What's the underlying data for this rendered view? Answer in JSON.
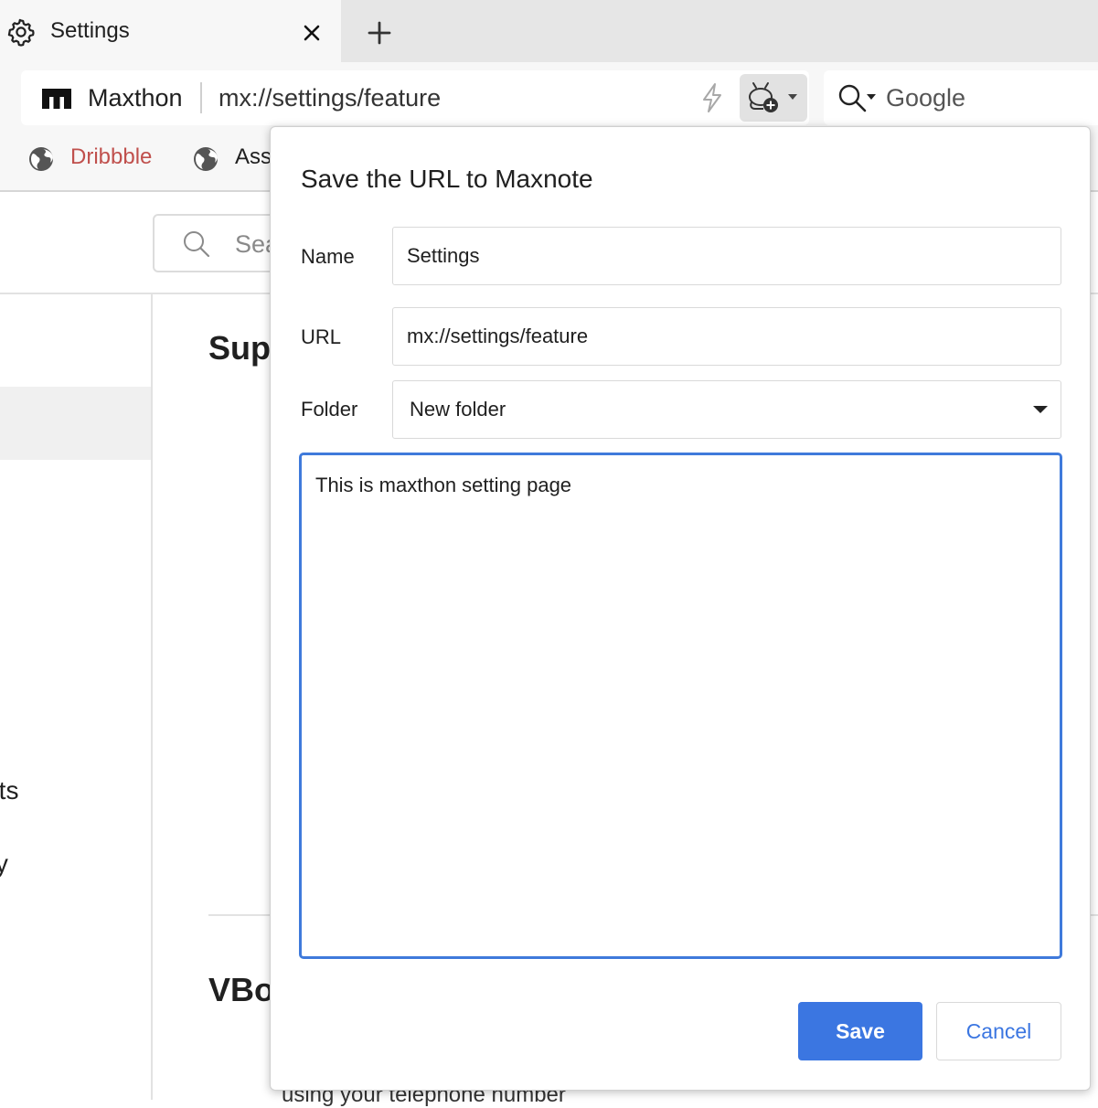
{
  "tab": {
    "title": "Settings",
    "icon": "gear-icon"
  },
  "address_bar": {
    "brand": "Maxthon",
    "url": "mx://settings/feature"
  },
  "search_box": {
    "engine": "Google"
  },
  "bookmarks": [
    {
      "label": "Dribbble",
      "color": "#c0504d"
    },
    {
      "label": "Asse"
    }
  ],
  "settings_page": {
    "search_placeholder": "Sea",
    "sidebar_items": [
      "rtcuts",
      "urity"
    ],
    "sections": [
      "Supe",
      "VBo"
    ],
    "footer_text": "using your telephone number"
  },
  "dialog": {
    "title": "Save the URL to Maxnote",
    "name_label": "Name",
    "name_value": "Settings",
    "url_label": "URL",
    "url_value": "mx://settings/feature",
    "folder_label": "Folder",
    "folder_value": "New folder",
    "note_text": "This is maxthon setting page",
    "save_label": "Save",
    "cancel_label": "Cancel"
  },
  "colors": {
    "accent": "#3b76e1",
    "focus_border": "#3f7adb",
    "bookmark_link": "#c0504d"
  }
}
